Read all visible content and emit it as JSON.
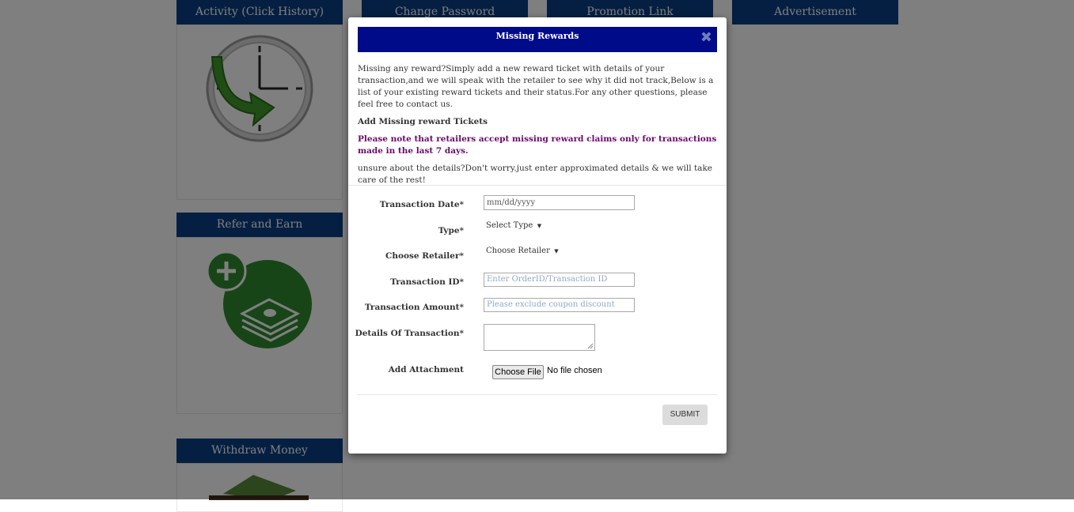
{
  "background": {
    "tiles": [
      {
        "title": "Activity (Click History)"
      },
      {
        "title": "Change Password"
      },
      {
        "title": "Promotion Link"
      },
      {
        "title": "Advertisement"
      },
      {
        "title": "Refer and Earn"
      },
      {
        "title": "Withdraw Money"
      }
    ]
  },
  "modal": {
    "title": "Missing Rewards",
    "close_icon": "close-icon",
    "intro": "Missing any reward?Simply add a new reward ticket with details of your transaction,and we will speak with the retailer to see why it did not track,Below is a list of your existing reward tickets and their status.For any other questions, please feel free to contact us.",
    "section_title": "Add Missing reward Tickets",
    "note": "Please note that retailers accept missing reward claims only for transactions made in the last 7 days.",
    "unsure": "unsure about the details?Don't worry.just enter approximated details & we will take care of the rest!",
    "form": {
      "date_label": "Transaction Date*",
      "date_value": "mm/dd/yyyy",
      "type_label": "Type*",
      "type_value": "Select Type",
      "retailer_label": "Choose Retailer*",
      "retailer_value": "Choose Retailer",
      "txid_label": "Transaction ID*",
      "txid_placeholder": "Enter OrderID/Transaction ID",
      "amount_label": "Transaction Amount*",
      "amount_placeholder": "Please exclude coupon discount",
      "details_label": "Details Of Transaction*",
      "attachment_label": "Add Attachment",
      "file_button": "Choose File",
      "file_status": "No file chosen"
    },
    "submit_label": "SUBMIT"
  },
  "colors": {
    "tile_header": "#0b3f85",
    "modal_header": "#000b8a",
    "note_text": "#6a0a6a",
    "icon_green": "#2f8a2f"
  }
}
